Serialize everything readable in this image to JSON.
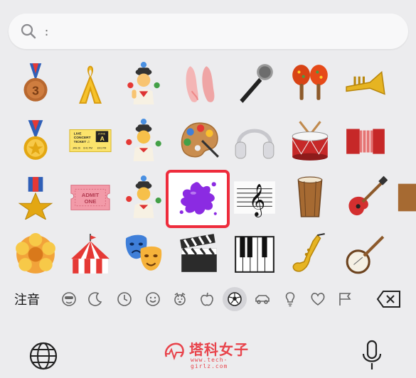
{
  "search": {
    "placeholder": "",
    "value": "",
    "caret": ":"
  },
  "emoji_grid": {
    "rows": [
      [
        "3rd place medal",
        "yellow ribbon",
        "juggling woman",
        "ballet shoes",
        "microphone",
        "maracas",
        "trumpet"
      ],
      [
        "sports medal",
        "concert ticket",
        "juggling person",
        "artist palette",
        "headphones",
        "drum",
        "accordion"
      ],
      [
        "military medal",
        "admission ticket",
        "juggling man",
        "paint splash",
        "musical score",
        "long drum",
        "guitar"
      ],
      [
        "rosette",
        "circus tent",
        "performing arts",
        "clapper board",
        "musical keyboard",
        "saxophone",
        "banjo"
      ]
    ],
    "ticket_text": {
      "live": "LIVE",
      "concert": "CONCERT",
      "ticket": "TICKET ♫",
      "zone": "ZONE",
      "zone_letter": "A",
      "date": "JAN 26",
      "time1": "8:41 PM",
      "time2": "8:41 PM"
    },
    "admit_text": {
      "line1": "ADMIT",
      "line2": "ONE"
    },
    "selected": "paint splash"
  },
  "category_bar": {
    "label": "注音",
    "categories": [
      "smileys-people",
      "recent",
      "frequently-used",
      "emoji-face",
      "animals-nature",
      "food-drink",
      "activity",
      "travel-places",
      "objects",
      "symbols",
      "flags"
    ],
    "active": "activity"
  },
  "bottom_bar": {
    "logo_name": "塔科女子",
    "logo_url": "www.tech-girlz.com"
  },
  "colors": {
    "highlight": "#ee2c3c",
    "logo": "#e8434b",
    "background": "#ececee"
  }
}
